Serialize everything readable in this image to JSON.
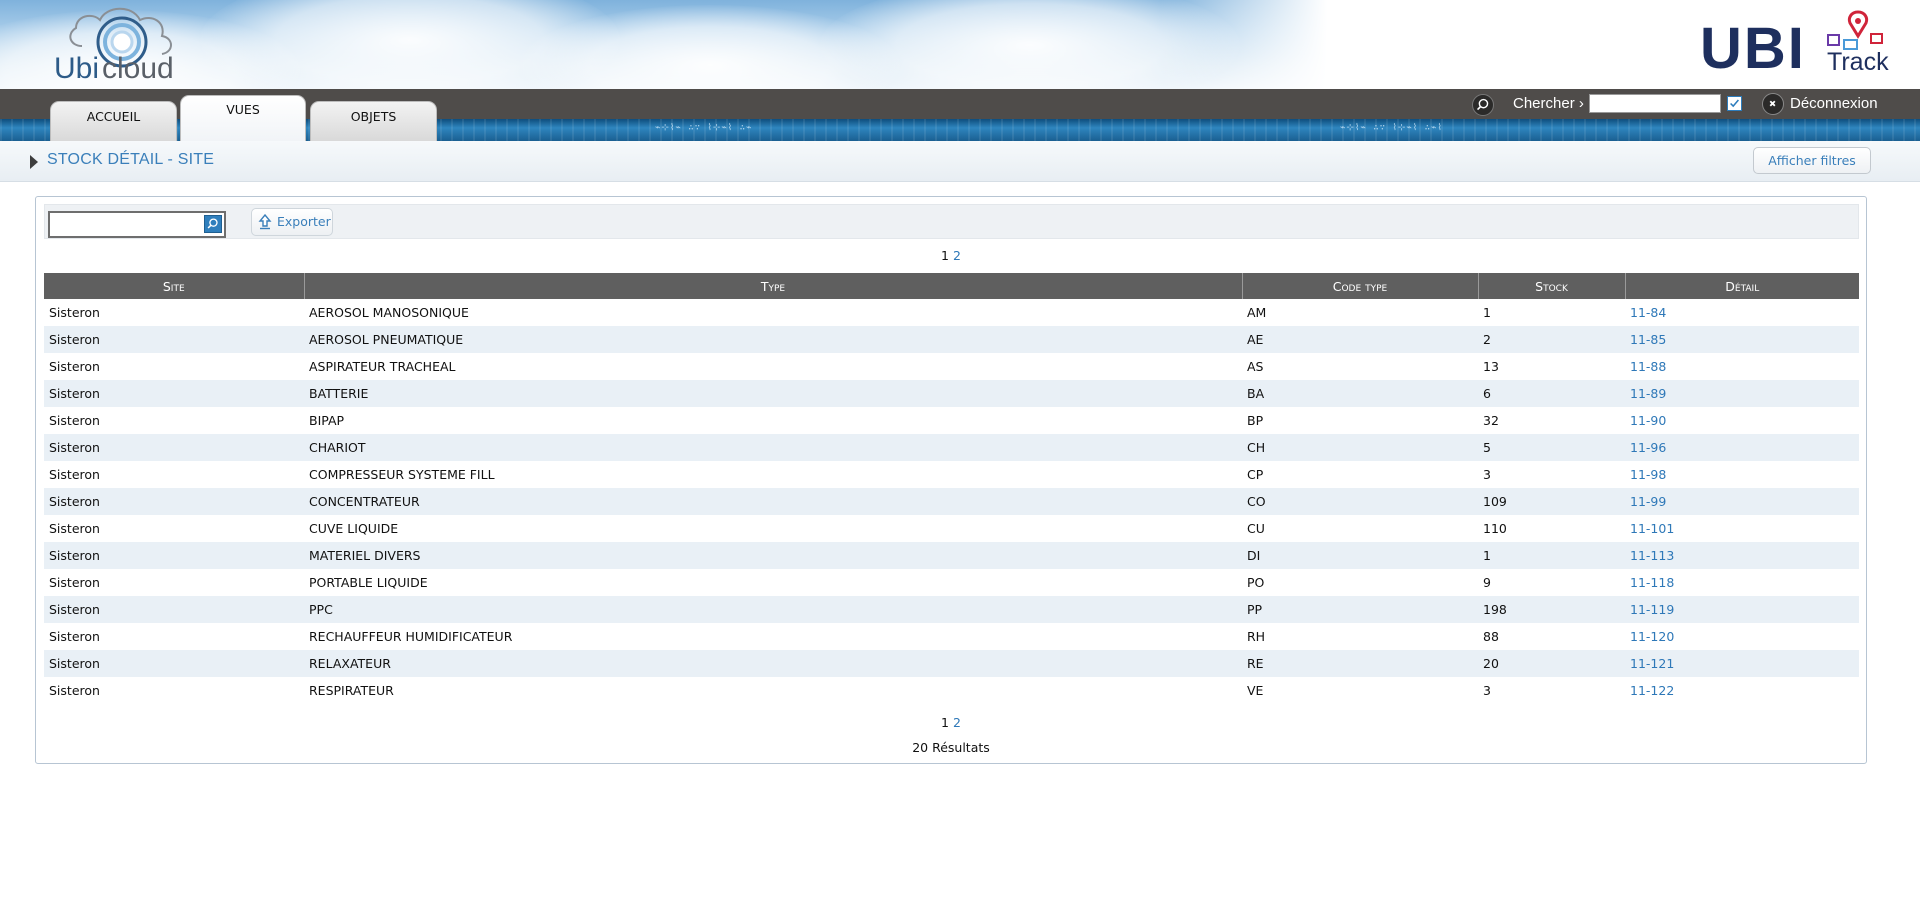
{
  "header": {
    "brand_left": "Ubicloud",
    "brand_right_ubi": "UBI",
    "brand_right_track": "Track"
  },
  "nav": {
    "tabs": [
      {
        "label": "ACCUEIL",
        "active": false
      },
      {
        "label": "VUES",
        "active": true
      },
      {
        "label": "OBJETS",
        "active": false
      }
    ],
    "search_label": "Chercher ›",
    "search_value": "",
    "logout_label": "Déconnexion"
  },
  "page": {
    "title": "STOCK DÉTAIL - SITE",
    "filters_button": "Afficher filtres"
  },
  "toolbar": {
    "search_value": "",
    "export_label": "Exporter"
  },
  "pagination": {
    "current": "1",
    "other": "2"
  },
  "table": {
    "headers": [
      "Site",
      "Type",
      "Code type",
      "Stock",
      "Détail"
    ],
    "rows": [
      [
        "Sisteron",
        "AEROSOL MANOSONIQUE",
        "AM",
        "1",
        "11-84"
      ],
      [
        "Sisteron",
        "AEROSOL PNEUMATIQUE",
        "AE",
        "2",
        "11-85"
      ],
      [
        "Sisteron",
        "ASPIRATEUR TRACHEAL",
        "AS",
        "13",
        "11-88"
      ],
      [
        "Sisteron",
        "BATTERIE",
        "BA",
        "6",
        "11-89"
      ],
      [
        "Sisteron",
        "BIPAP",
        "BP",
        "32",
        "11-90"
      ],
      [
        "Sisteron",
        "CHARIOT",
        "CH",
        "5",
        "11-96"
      ],
      [
        "Sisteron",
        "COMPRESSEUR SYSTEME FILL",
        "CP",
        "3",
        "11-98"
      ],
      [
        "Sisteron",
        "CONCENTRATEUR",
        "CO",
        "109",
        "11-99"
      ],
      [
        "Sisteron",
        "CUVE LIQUIDE",
        "CU",
        "110",
        "11-101"
      ],
      [
        "Sisteron",
        "MATERIEL DIVERS",
        "DI",
        "1",
        "11-113"
      ],
      [
        "Sisteron",
        "PORTABLE LIQUIDE",
        "PO",
        "9",
        "11-118"
      ],
      [
        "Sisteron",
        "PPC",
        "PP",
        "198",
        "11-119"
      ],
      [
        "Sisteron",
        "RECHAUFFEUR HUMIDIFICATEUR",
        "RH",
        "88",
        "11-120"
      ],
      [
        "Sisteron",
        "RELAXATEUR",
        "RE",
        "20",
        "11-121"
      ],
      [
        "Sisteron",
        "RESPIRATEUR",
        "VE",
        "3",
        "11-122"
      ]
    ]
  },
  "results": "20 Résultats",
  "colors": {
    "accent": "#3a7fba",
    "link": "#2e78b8",
    "header_row": "#5f5f5f",
    "alt_row": "#e9f0f6",
    "navbar": "#4f4c4a"
  },
  "icons": {
    "search": "magnifier-icon",
    "logout": "close-icon",
    "export": "upload-arrow-icon",
    "breadcrumb": "triangle-right-icon"
  }
}
